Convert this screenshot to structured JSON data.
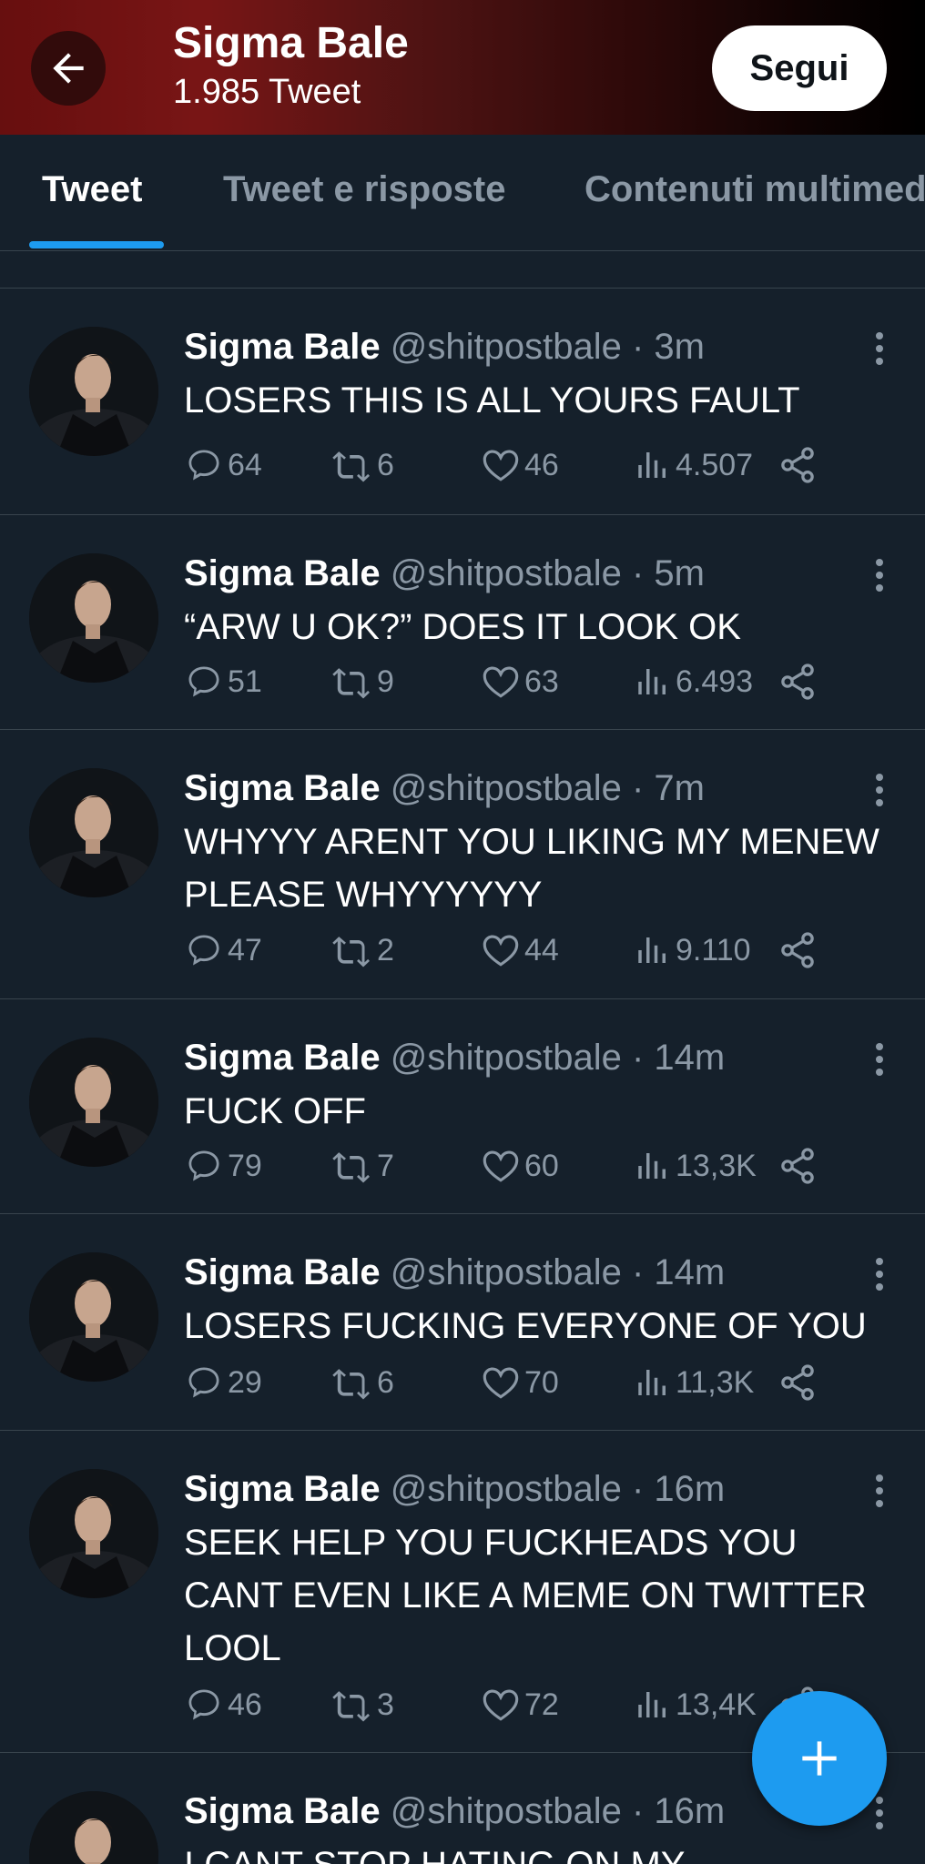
{
  "header": {
    "title": "Sigma Bale",
    "subtitle": "1.985 Tweet",
    "follow_label": "Segui",
    "back_icon": "arrow-left-icon"
  },
  "tabs": [
    {
      "label": "Tweet",
      "active": true
    },
    {
      "label": "Tweet e risposte",
      "active": false
    },
    {
      "label": "Contenuti multimediali",
      "active": false
    }
  ],
  "tweets": [
    {
      "name": "Sigma Bale",
      "meta": " @shitpostbale · 3m",
      "text": "LOSERS THIS IS ALL YOURS FAULT",
      "replies": "64",
      "retweets": "6",
      "likes": "46",
      "views": "4.507"
    },
    {
      "name": "Sigma Bale",
      "meta": " @shitpostbale · 5m",
      "text": "“ARW U OK?” DOES IT LOOK OK",
      "replies": "51",
      "retweets": "9",
      "likes": "63",
      "views": "6.493"
    },
    {
      "name": "Sigma Bale",
      "meta": " @shitpostbale · 7m",
      "text": "WHYYY ARENT YOU LIKING MY MENEW PLEASE WHYYYYYY",
      "replies": "47",
      "retweets": "2",
      "likes": "44",
      "views": "9.110"
    },
    {
      "name": "Sigma Bale",
      "meta": " @shitpostbale · 14m",
      "text": "FUCK OFF",
      "replies": "79",
      "retweets": "7",
      "likes": "60",
      "views": "13,3K"
    },
    {
      "name": "Sigma Bale",
      "meta": " @shitpostbale · 14m",
      "text": "LOSERS FUCKING EVERYONE OF YOU",
      "replies": "29",
      "retweets": "6",
      "likes": "70",
      "views": "11,3K"
    },
    {
      "name": "Sigma Bale",
      "meta": " @shitpostbale · 16m",
      "text": "SEEK HELP YOU FUCKHEADS YOU CANT EVEN LIKE A MEME ON TWITTER LOOL",
      "replies": "46",
      "retweets": "3",
      "likes": "72",
      "views": "13,4K"
    },
    {
      "name": "Sigma Bale",
      "meta": " @shitpostbale · 16m",
      "text": "I CANT STOP HATING ON MY",
      "replies": "",
      "retweets": "",
      "likes": "",
      "views": ""
    }
  ],
  "fab": {
    "icon": "plus-icon"
  },
  "colors": {
    "accent": "#1d9bf0",
    "background": "#15202b",
    "muted": "#8b98a5",
    "divider": "#38444d"
  }
}
